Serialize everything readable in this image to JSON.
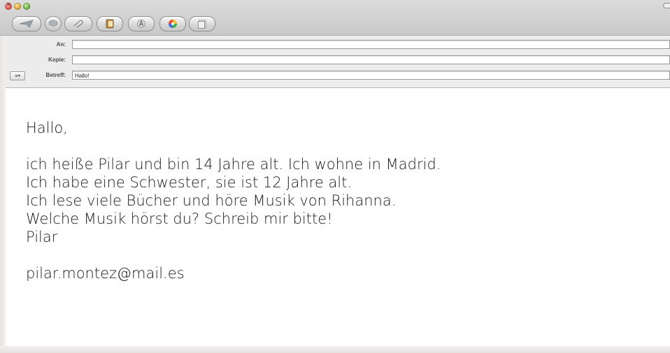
{
  "toolbar": {
    "buttons": [
      {
        "name": "send",
        "icon": "send-icon"
      },
      {
        "name": "chat",
        "icon": "chat-bubble-icon"
      },
      {
        "name": "attach",
        "icon": "paperclip-icon"
      },
      {
        "name": "address",
        "icon": "address-book-icon"
      },
      {
        "name": "fonts",
        "icon": "fonts-icon"
      },
      {
        "name": "colors",
        "icon": "color-wheel-icon"
      },
      {
        "name": "stationery",
        "icon": "stationery-icon"
      }
    ]
  },
  "header": {
    "to_label": "An:",
    "to_value": "",
    "cc_label": "Kopie:",
    "cc_value": "",
    "subject_label": "Betreff:",
    "subject_value": "Hallo!",
    "account_button": "≡▾"
  },
  "message": {
    "greeting": "Hallo,",
    "lines": [
      "ich heiße Pilar und bin 14 Jahre alt. Ich wohne in Madrid.",
      "Ich habe eine Schwester, sie ist 12 Jahre alt.",
      "Ich lese viele Bücher und höre Musik von Rihanna.",
      "Welche Musik hörst du? Schreib mir bitte!",
      "Pilar"
    ],
    "email": "pilar.montez@mail.es"
  }
}
